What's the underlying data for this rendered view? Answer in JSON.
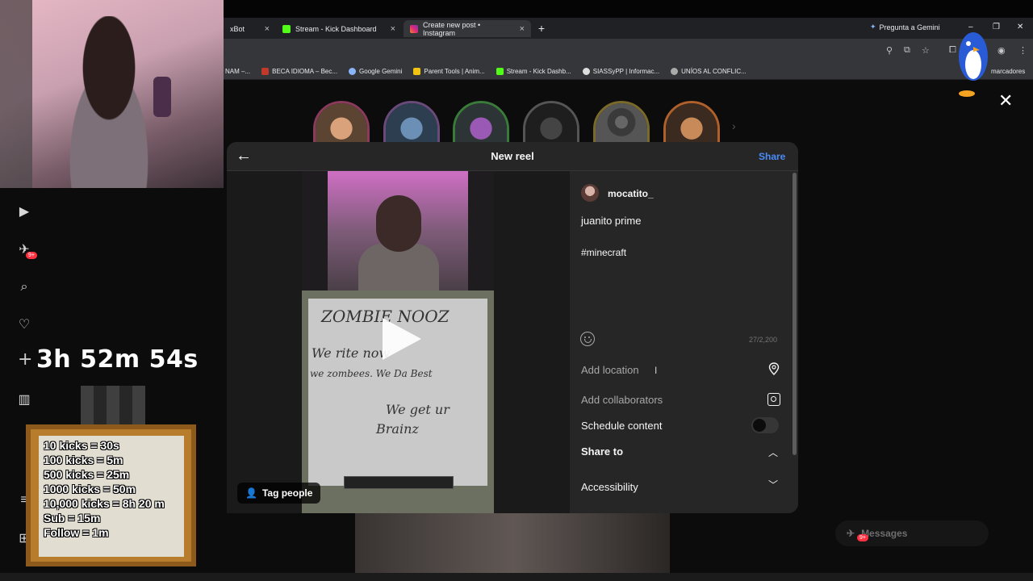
{
  "browser": {
    "tabs": [
      {
        "label": "xBot",
        "color": "#202124"
      },
      {
        "label": "Stream - Kick Dashboard",
        "color": "#53fc18"
      },
      {
        "label": "Create new post • Instagram",
        "color": "#e1306c"
      }
    ],
    "gemini_label": "Pregunta a Gemini",
    "bookmarks": [
      {
        "label": "NAM –...",
        "color": "#888"
      },
      {
        "label": "BECA IDIOMA – Bec...",
        "color": "#c0392b"
      },
      {
        "label": "Google Gemini",
        "color": "#8ab4f8"
      },
      {
        "label": "Parent Tools | Anim...",
        "color": "#f1c40f"
      },
      {
        "label": "Stream - Kick Dashb...",
        "color": "#53fc18"
      },
      {
        "label": "SIASSyPP | Informac...",
        "color": "#dddddd"
      },
      {
        "label": "UNÍOS AL CONFLIC...",
        "color": "#aaaaaa"
      }
    ],
    "bookmarks_right": "marcadores"
  },
  "stream_overlay": {
    "timer": "3h 52m 54s",
    "timer_prefix": "+",
    "kick_rates": [
      "10 kicks = 30s",
      "100 kicks = 5m",
      "500 kicks = 25m",
      "1000 kicks = 50m",
      "10,000 kicks = 8h 20 m",
      "Sub = 15m",
      "Follow = 1m"
    ]
  },
  "sidebar": {
    "notif_badge": "9+"
  },
  "modal": {
    "title": "New reel",
    "share_label": "Share",
    "tag_people_label": "Tag people",
    "username": "mocatito_",
    "caption_line1": "juanito prime",
    "caption_line2": "#minecraft",
    "char_count": "27/2,200",
    "add_location": "Add location",
    "add_collaborators": "Add collaborators",
    "schedule_content": "Schedule content",
    "schedule_enabled": false,
    "share_to": "Share to",
    "accessibility": "Accessibility"
  },
  "video_note": {
    "line1": "ZOMBIE NOOZ",
    "line2": "We rite now",
    "line3": "we zombees. We Da Best",
    "line4": "We get ur",
    "line5": "Brainz"
  },
  "messages": {
    "label": "Messages",
    "badge": "9+"
  },
  "colors": {
    "accent_blue": "#4a8cf7",
    "modal_bg": "#262626",
    "badge_red": "#ff3040"
  }
}
